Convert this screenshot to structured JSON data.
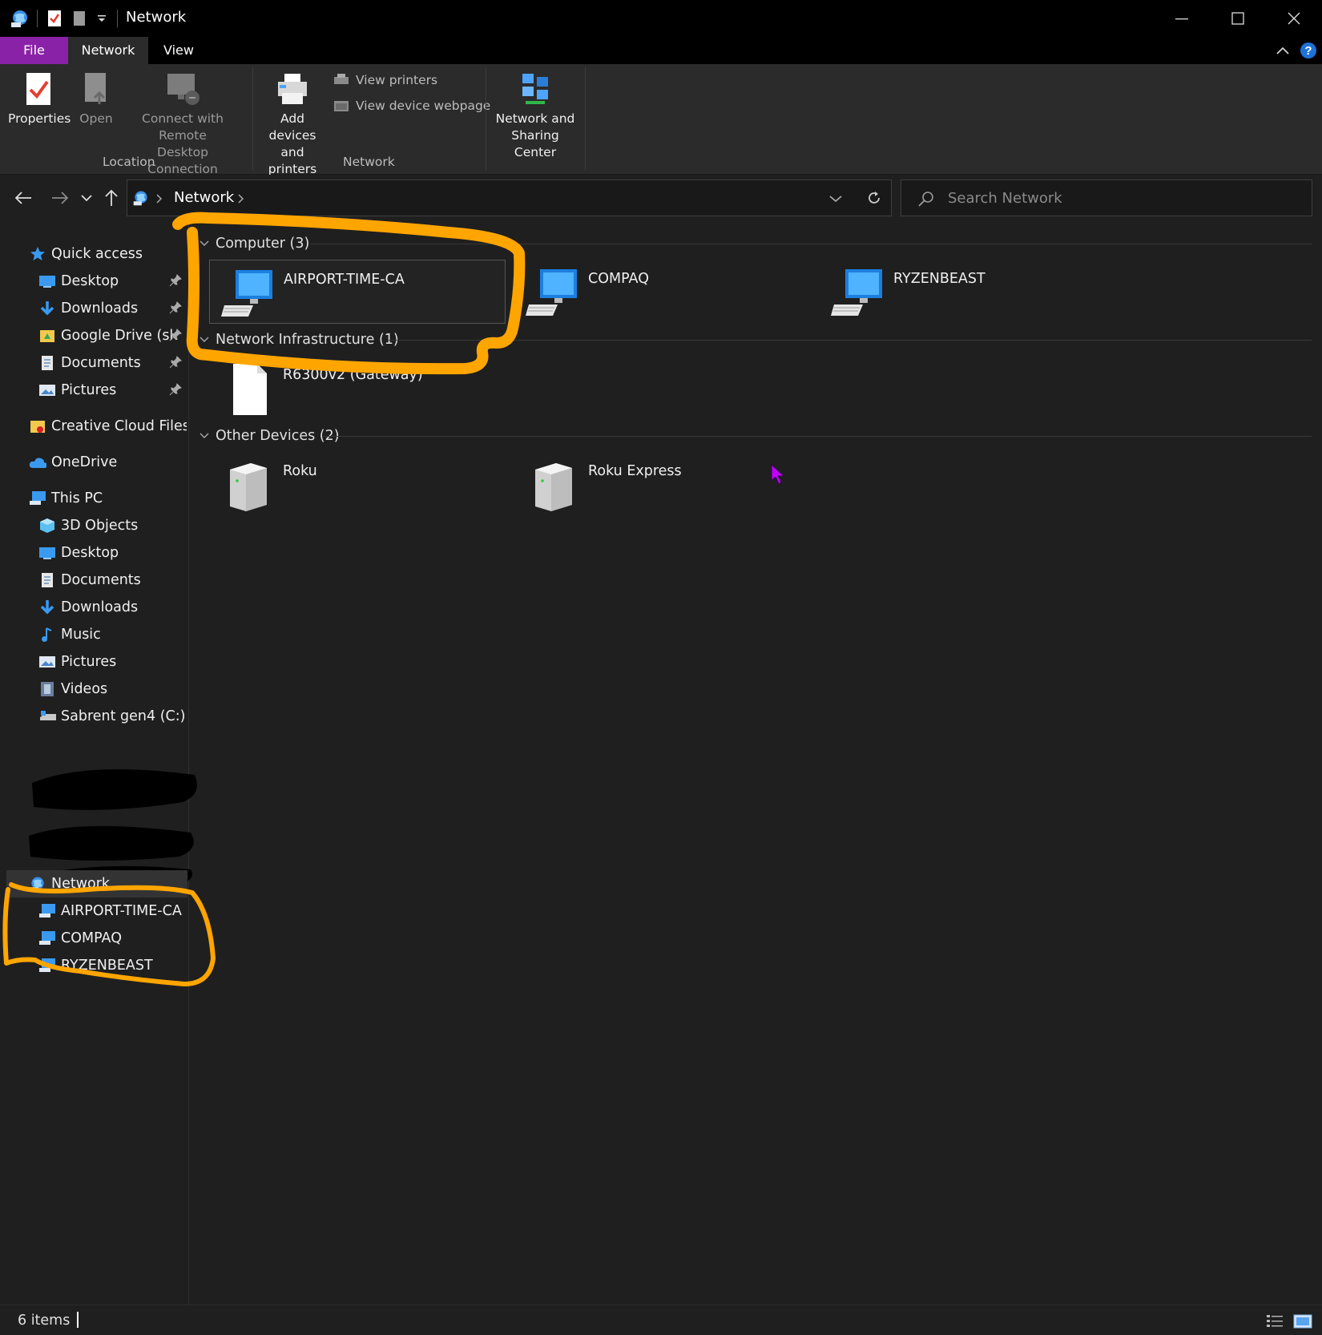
{
  "window": {
    "title": "Network"
  },
  "ribbon_tabs": [
    {
      "label": "File"
    },
    {
      "label": "Network"
    },
    {
      "label": "View"
    }
  ],
  "ribbon": {
    "properties": "Properties",
    "open": "Open",
    "connect_line1": "Connect with Remote",
    "connect_line2": "Desktop Connection",
    "location_group": "Location",
    "add_line1": "Add devices",
    "add_line2": "and printers",
    "view_printers": "View printers",
    "view_device_webpage": "View device webpage",
    "network_group": "Network",
    "nsc_line1": "Network and",
    "nsc_line2": "Sharing Center"
  },
  "address": {
    "crumb": "Network"
  },
  "search": {
    "placeholder": "Search Network"
  },
  "sidebar": {
    "quick_access": "Quick access",
    "quick_items": [
      {
        "label": "Desktop"
      },
      {
        "label": "Downloads"
      },
      {
        "label": "Google Drive (sk"
      },
      {
        "label": "Documents"
      },
      {
        "label": "Pictures"
      }
    ],
    "creative_cloud": "Creative Cloud Files",
    "onedrive": "OneDrive",
    "this_pc": "This PC",
    "pc_items": [
      {
        "label": "3D Objects"
      },
      {
        "label": "Desktop"
      },
      {
        "label": "Documents"
      },
      {
        "label": "Downloads"
      },
      {
        "label": "Music"
      },
      {
        "label": "Pictures"
      },
      {
        "label": "Videos"
      },
      {
        "label": "Sabrent gen4 (C:)"
      }
    ],
    "network": "Network",
    "network_items": [
      {
        "label": "AIRPORT-TIME-CA"
      },
      {
        "label": "COMPAQ"
      },
      {
        "label": "RYZENBEAST"
      }
    ]
  },
  "groups": {
    "computer": {
      "title": "Computer (3)",
      "items": [
        "AIRPORT-TIME-CA",
        "COMPAQ",
        "RYZENBEAST"
      ]
    },
    "infrastructure": {
      "title": "Network Infrastructure (1)",
      "items": [
        "R6300v2 (Gateway)"
      ]
    },
    "other": {
      "title": "Other Devices (2)",
      "items": [
        "Roku",
        "Roku Express"
      ]
    }
  },
  "status": {
    "items": "6 items"
  },
  "colors": {
    "accent": "#8a22a8",
    "annotation": "#ffa500",
    "cursor": "#c000ff"
  }
}
